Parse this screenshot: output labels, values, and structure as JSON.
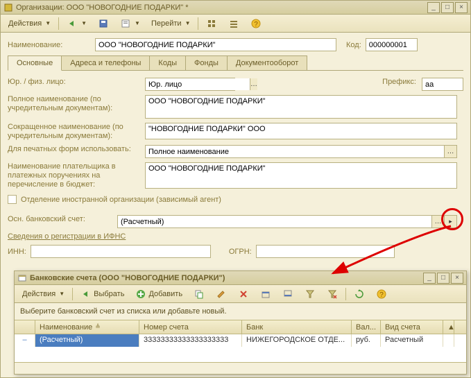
{
  "mainWindow": {
    "title": "Организации: ООО \"НОВОГОДНИЕ ПОДАРКИ\" *",
    "toolbar": {
      "actions": "Действия",
      "goto": "Перейти"
    },
    "name_label": "Наименование:",
    "name_value": "ООО \"НОВОГОДНИЕ ПОДАРКИ\"",
    "code_label": "Код:",
    "code_value": "000000001",
    "tabs": [
      "Основные",
      "Адреса и телефоны",
      "Коды",
      "Фонды",
      "Документооборот"
    ],
    "form": {
      "entity_type_label": "Юр. / физ. лицо:",
      "entity_type_value": "Юр. лицо",
      "prefix_label": "Префикс:",
      "prefix_value": "аа",
      "fullname_label": "Полное наименование (по учредительным документам):",
      "fullname_value": "ООО \"НОВОГОДНИЕ ПОДАРКИ\"",
      "shortname_label": "Сокращенное наименование (по учредительным документам):",
      "shortname_value": "\"НОВОГОДНИЕ ПОДАРКИ\" ООО",
      "printform_label": "Для печатных форм использовать:",
      "printform_value": "Полное наименование",
      "payer_label": "Наименование плательщика в платежных поручениях на перечисление в бюджет:",
      "payer_value": "ООО \"НОВОГОДНИЕ ПОДАРКИ\"",
      "foreign_branch": "Отделение иностранной организации (зависимый агент)",
      "bank_account_label": "Осн. банковский счет:",
      "bank_account_value": "(Расчетный)",
      "ifns_section": "Сведения о регистрации в ИФНС",
      "inn_label": "ИНН:",
      "ogrn_label": "ОГРН:"
    }
  },
  "subWindow": {
    "title": "Банковские счета (ООО \"НОВОГОДНИЕ ПОДАРКИ\")",
    "toolbar": {
      "actions": "Действия",
      "select": "Выбрать",
      "add": "Добавить"
    },
    "hint": "Выберите банковский счет из списка или добавьте новый.",
    "columns": [
      "",
      "Наименование",
      "Номер счета",
      "Банк",
      "Вал...",
      "Вид счета"
    ],
    "rows": [
      {
        "icon": "–",
        "name": "(Расчетный)",
        "number": "33333333333333333333",
        "bank": "НИЖЕГОРОДСКОЕ ОТДЕ...",
        "currency": "руб.",
        "type": "Расчетный"
      }
    ]
  }
}
